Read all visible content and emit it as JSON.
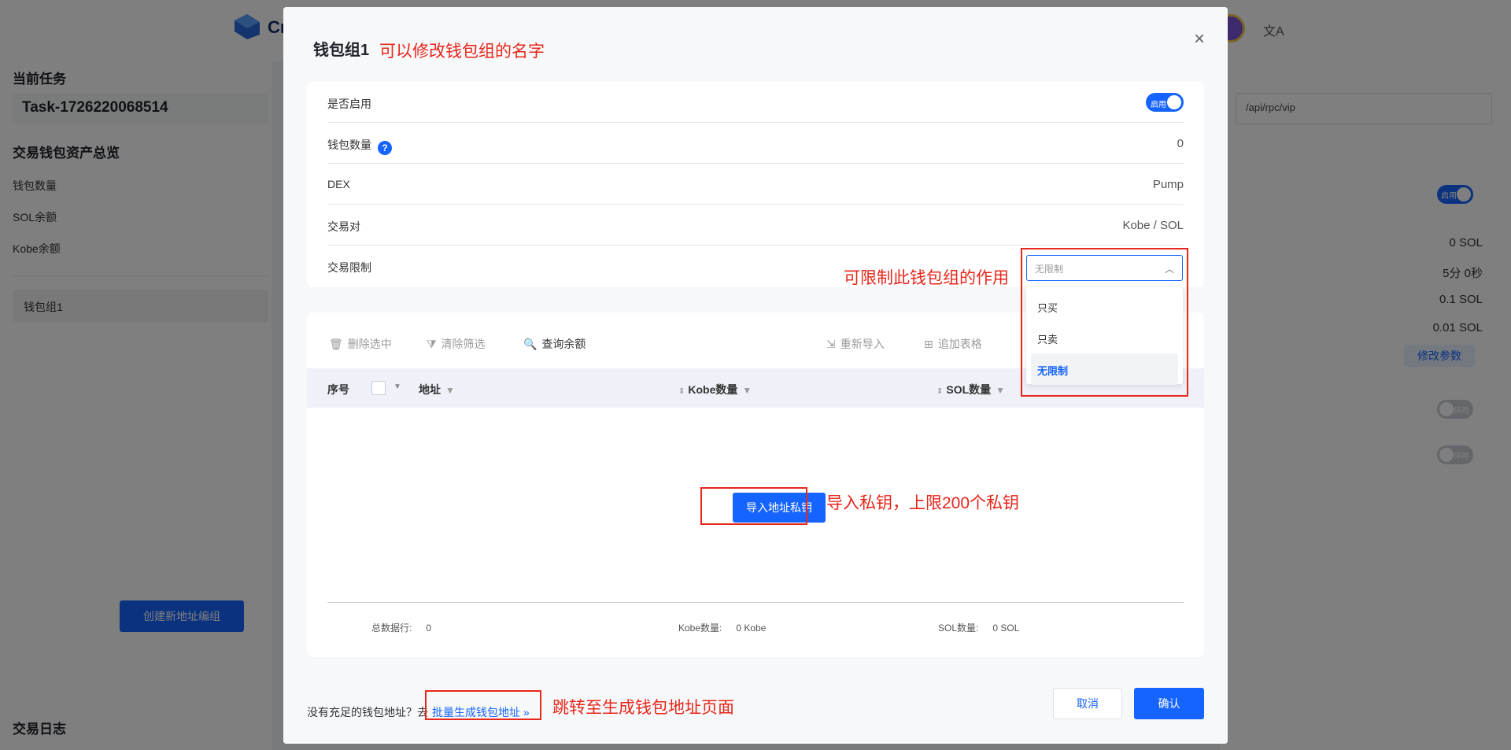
{
  "background": {
    "logo_text": "Cr",
    "lang_icon": "文A",
    "left": {
      "current_task_title": "当前任务",
      "task_name": "Task-1726220068514",
      "assets_title": "交易钱包资产总览",
      "rows": [
        "钱包数量",
        "SOL余额",
        "Kobe余额"
      ],
      "group_item": "钱包组1",
      "create_button": "创建新地址编组",
      "log_title": "交易日志"
    },
    "right": {
      "rpc_value": "/api/rpc/vip",
      "toggle_label": "启用",
      "toggle_off_label": "停用",
      "values": [
        "0 SOL",
        "5分 0秒",
        "0.1 SOL",
        "0.01 SOL"
      ],
      "modify_button": "修改参数"
    }
  },
  "modal": {
    "title": "钱包组1",
    "annotations": {
      "rename": "可以修改钱包组的名字",
      "restrict": "可限制此钱包组的作用",
      "import": "导入私钥，上限200个私钥",
      "jump": "跳转至生成钱包地址页面"
    },
    "info": {
      "enabled_label": "是否启用",
      "toggle_label": "启用",
      "wallet_count_label": "钱包数量",
      "help": "?",
      "wallet_count_value": "0",
      "dex_label": "DEX",
      "dex_value": "Pump",
      "pair_label": "交易对",
      "pair_value": "Kobe / SOL",
      "limit_label": "交易限制"
    },
    "select": {
      "value": "无限制",
      "options": [
        "只买",
        "只卖",
        "无限制"
      ],
      "selected_index": 2
    },
    "toolbar": {
      "delete_selected": "删除选中",
      "clear_filter": "清除筛选",
      "query_balance": "查询余额",
      "reimport": "重新导入",
      "append_table": "追加表格"
    },
    "table": {
      "col_index": "序号",
      "col_address": "地址",
      "col_kobe": "Kobe数量",
      "col_sol": "SOL数量"
    },
    "import_button": "导入地址私钥",
    "summary": {
      "total_label": "总数据行:",
      "total_value": "0",
      "kobe_label": "Kobe数量:",
      "kobe_value": "0 Kobe",
      "sol_label": "SOL数量:",
      "sol_value": "0 SOL"
    },
    "footer": {
      "prompt": "没有充足的钱包地址？去",
      "link": "批量生成钱包地址",
      "cancel": "取消",
      "confirm": "确认"
    }
  }
}
